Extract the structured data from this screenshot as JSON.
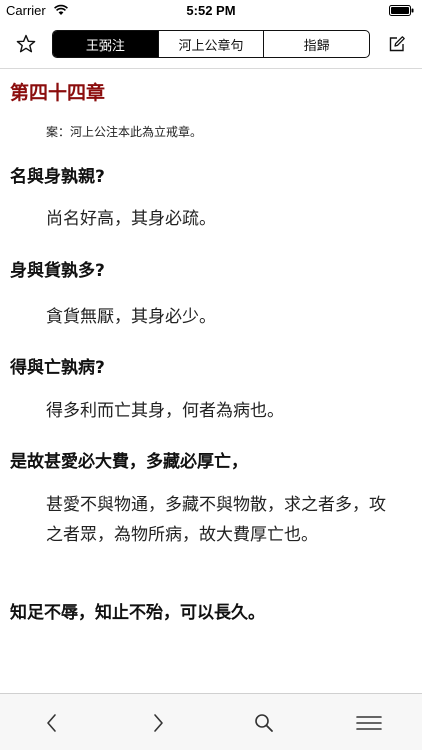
{
  "status_bar": {
    "carrier": "Carrier",
    "time": "5:52 PM"
  },
  "toolbar": {
    "tabs": [
      {
        "label": "王弼注",
        "active": true
      },
      {
        "label": "河上公章句",
        "active": false
      },
      {
        "label": "指歸",
        "active": false
      }
    ],
    "favorite_icon": "star-icon",
    "edit_icon": "edit-icon"
  },
  "content": {
    "chapter_title": "第四十四章",
    "note": "案：河上公注本此為立戒章。",
    "verses": [
      {
        "q": "名與身孰親?",
        "a": "尚名好高，其身必疏。"
      },
      {
        "q": "身與貨孰多?",
        "a": "貪貨無厭，其身必少。"
      },
      {
        "q": "得與亡孰病?",
        "a": "得多利而亡其身，何者為病也。"
      },
      {
        "q": "是故甚愛必大費，多藏必厚亡，",
        "a": "甚愛不與物通，多藏不與物散，求之者多，攻之者眾，為物所病，故大費厚亡也。"
      },
      {
        "q": "知足不辱，知止不殆，可以長久。",
        "a": ""
      }
    ]
  },
  "bottom_bar": {
    "icons": [
      "chevron-left-icon",
      "chevron-right-icon",
      "search-icon",
      "menu-icon"
    ]
  }
}
